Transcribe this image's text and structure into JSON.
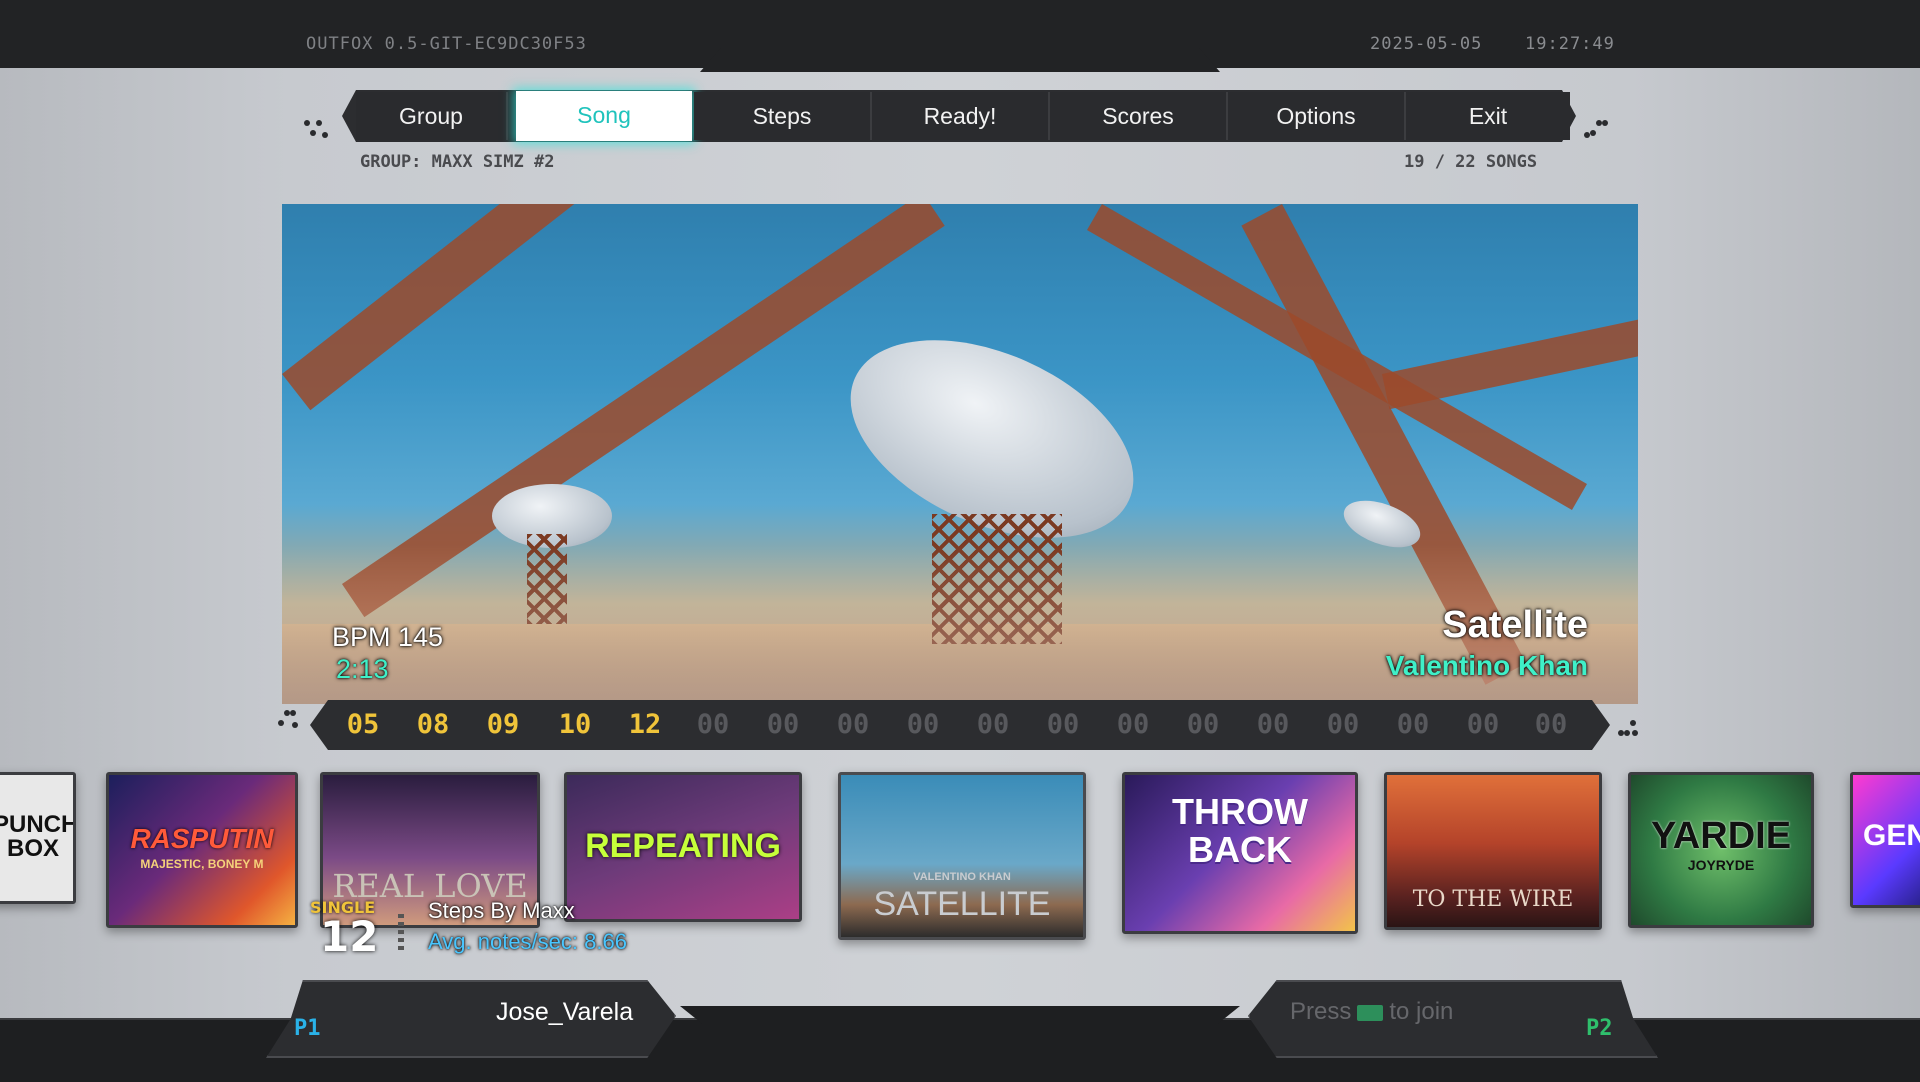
{
  "header": {
    "version": "OUTFOX 0.5-GIT-EC9DC30F53",
    "date": "2025-05-05",
    "time": "19:27:49"
  },
  "tabs": [
    {
      "label": "Group"
    },
    {
      "label": "Song",
      "active": true
    },
    {
      "label": "Steps"
    },
    {
      "label": "Ready!"
    },
    {
      "label": "Scores"
    },
    {
      "label": "Options"
    },
    {
      "label": "Exit"
    }
  ],
  "group": {
    "label": "GROUP: MAXX SIMZ #2",
    "count": "19 / 22 SONGS"
  },
  "song": {
    "bpm": "BPM 145",
    "length": "2:13",
    "title": "Satellite",
    "artist": "Valentino Khan"
  },
  "difficulties": {
    "active": [
      "05",
      "08",
      "09",
      "10",
      "12"
    ],
    "inactive": [
      "00",
      "00",
      "00",
      "00",
      "00",
      "00",
      "00",
      "00",
      "00",
      "00",
      "00",
      "00",
      "00"
    ]
  },
  "wheel": [
    {
      "title": "PUNCH BOX"
    },
    {
      "title": "RASPUTIN",
      "subtitle": "MAJESTIC, BONEY M"
    },
    {
      "title": "REAL LOVE"
    },
    {
      "title": "REPEATING"
    },
    {
      "title": "SATELLITE",
      "subtitle": "VALENTINO KHAN"
    },
    {
      "title": "THROW BACK"
    },
    {
      "title": "TO THE WIRE"
    },
    {
      "title": "YARDIE",
      "subtitle": "JOYRYDE"
    },
    {
      "title": "GEN"
    }
  ],
  "steps": {
    "style": "SINGLE",
    "meter": "12",
    "author": "Steps By Maxx",
    "nps": "Avg. notes/sec: 8.66"
  },
  "players": {
    "p1": {
      "tag": "P1",
      "name": "Jose_Varela"
    },
    "p2": {
      "tag": "P2",
      "press": "Press",
      "join": "to join"
    }
  },
  "colors": {
    "accent": "#1fc3bc",
    "difficulty": "#f0c43a",
    "artist": "#3ff0c8",
    "nps": "#49c6ff"
  }
}
